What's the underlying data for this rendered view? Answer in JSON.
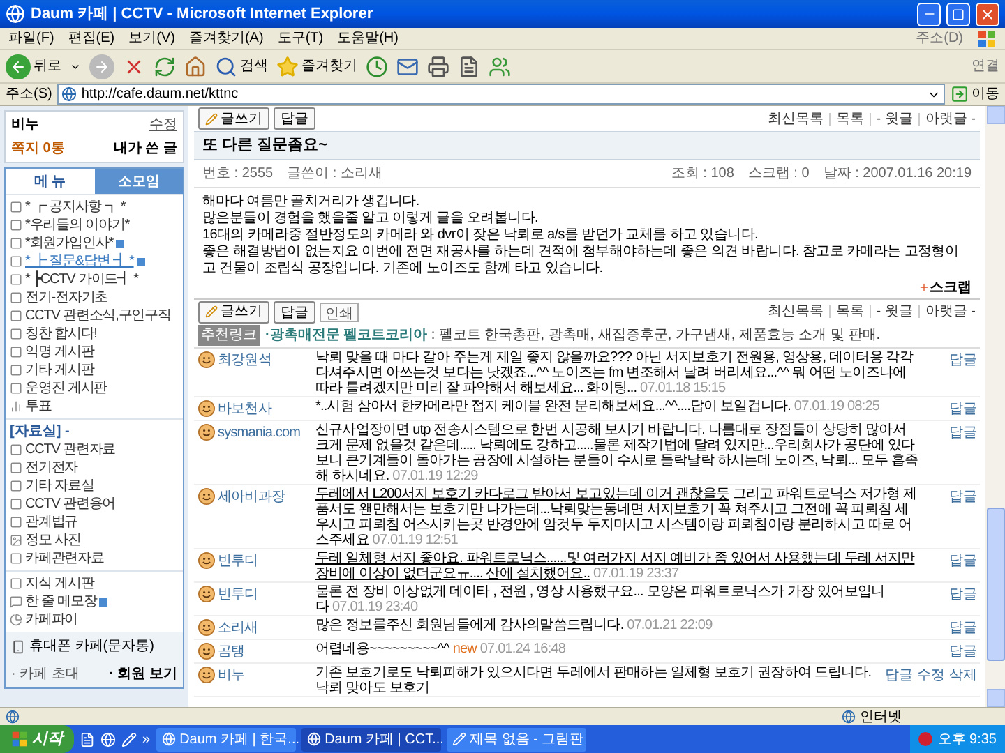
{
  "window": {
    "title": "Daum 카페 | CCTV - Microsoft Internet Explorer"
  },
  "menu_bar": {
    "items": [
      "파일(F)",
      "편집(E)",
      "보기(V)",
      "즐겨찾기(A)",
      "도구(T)",
      "도움말(H)"
    ],
    "right": "주소(D)"
  },
  "toolbar": {
    "back": "뒤로",
    "search": "검색",
    "favorites": "즐겨찾기",
    "links": "연결"
  },
  "address_bar": {
    "label": "주소(S)",
    "url": "http://cafe.daum.net/kttnc",
    "go": "이동"
  },
  "sidebar": {
    "user": {
      "name": "비누",
      "edit": "수정",
      "messages": "쪽지 0통",
      "my_posts": "내가 쓴 글"
    },
    "tabs": [
      {
        "label": "메 뉴",
        "selected": true
      },
      {
        "label": "소모임",
        "selected": false
      }
    ],
    "groups": [
      {
        "items": [
          {
            "kind": "board",
            "label": "* ┏ 공지사항 ┓ *",
            "new": false,
            "selected": false
          },
          {
            "kind": "board",
            "label": "*우리들의 이야기*",
            "new": false,
            "selected": false
          },
          {
            "kind": "board",
            "label": "*회원가입인사*",
            "new": true,
            "selected": false
          },
          {
            "kind": "board",
            "label": "* ┣ 질문&답변 ┫ *",
            "new": true,
            "selected": true
          },
          {
            "kind": "board",
            "label": "* ┣CCTV 가이드┫ *",
            "new": false,
            "selected": false
          },
          {
            "kind": "board",
            "label": "전기-전자기초",
            "new": false,
            "selected": false
          },
          {
            "kind": "board",
            "label": "CCTV 관련소식,구인구직",
            "new": false,
            "selected": false
          },
          {
            "kind": "board",
            "label": "칭찬 합시다!",
            "new": false,
            "selected": false
          },
          {
            "kind": "board",
            "label": "익명 게시판",
            "new": false,
            "selected": false
          },
          {
            "kind": "board",
            "label": "기타 게시판",
            "new": false,
            "selected": false
          },
          {
            "kind": "board",
            "label": "운영진 게시판",
            "new": false,
            "selected": false
          },
          {
            "kind": "poll",
            "label": "투표",
            "new": false,
            "selected": false
          }
        ]
      },
      {
        "header": "[자료실] -",
        "items": [
          {
            "kind": "board",
            "label": "CCTV 관련자료",
            "new": false,
            "selected": false
          },
          {
            "kind": "board",
            "label": "전기전자",
            "new": false,
            "selected": false
          },
          {
            "kind": "board",
            "label": "기타 자료실",
            "new": false,
            "selected": false
          },
          {
            "kind": "board",
            "label": "CCTV 관련용어",
            "new": false,
            "selected": false
          },
          {
            "kind": "board",
            "label": "관계법규",
            "new": false,
            "selected": false
          },
          {
            "kind": "photo",
            "label": "정모 사진",
            "new": false,
            "selected": false
          },
          {
            "kind": "board",
            "label": "카페관련자료",
            "new": false,
            "selected": false
          }
        ]
      },
      {
        "items": [
          {
            "kind": "board",
            "label": "지식 게시판",
            "new": false,
            "selected": false
          },
          {
            "kind": "memo",
            "label": "한 줄 메모장",
            "new": true,
            "selected": false
          },
          {
            "kind": "pie",
            "label": "카페파이",
            "new": false,
            "selected": false
          }
        ]
      }
    ],
    "mobile": "휴대폰 카페(문자통)",
    "footer_links": [
      "· 카페 초대",
      "· 회원 보기"
    ]
  },
  "post": {
    "buttons": [
      {
        "kind": "write",
        "label": "글쓰기"
      },
      {
        "kind": "plain",
        "label": "답글"
      }
    ],
    "nav_links": [
      "최신목록",
      "목록",
      "- 윗글",
      "아랫글 -"
    ],
    "title": "또 다른 질문좀요~",
    "meta_left": [
      "번호 : 2555",
      "글쓴이 : 소리새"
    ],
    "meta_right": [
      "조회 : 108",
      "스크랩 : 0",
      "날짜 : 2007.01.16 20:19"
    ],
    "body": [
      "해마다 여름만 골치거리가 생깁니다.",
      "많은분들이 경험을 했을줄 알고 이렇게 글을 오려봅니다.",
      "16대의 카메라중 절반정도의 카메라 와 dvr이 잦은 낙뢰로 a/s를 받던가 교체를 하고 있습니다.",
      "좋은 해결방법이 없는지요 이번에 전면 재공사를 하는데 견적에 첨부해야하는데 좋은 의견 바랍니다. 참고로 카메라는 고정형이고 건물이 조립식 공장입니다. 기존에 노이즈도 함께 타고 있습니다."
    ],
    "scrap": "스크랩",
    "buttons_2": [
      {
        "kind": "write",
        "label": "글쓰기"
      },
      {
        "kind": "plain",
        "label": "답글"
      },
      {
        "kind": "small",
        "label": "인쇄"
      }
    ],
    "nav_links_2": [
      "최신목록",
      "목록",
      "- 윗글",
      "아랫글 -"
    ],
    "ad": {
      "label": "추천링크",
      "link": "·광촉매전문 펠코트코리아",
      "text": ": 펠코트 한국총판, 광촉매, 새집증후군, 가구냄새, 제품효능 소개 및 판매."
    }
  },
  "comments": [
    {
      "name": "최강원석",
      "text": "낙뢰 맞을 때 마다 갈아 주는게 제일 좋지 않을까요??? 아닌 서지보호기 전원용, 영상용, 데이터용 각각 다셔주시면 아쓰는것 보다는 낫겠죠...^^ 노이즈는 fm 변조해서 날려 버리세요...^^ 뭐 어떤 노이즈냐에 따라 틀려겠지만 미리 잘 파악해서 해보세요... 화이팅...",
      "date": "07.01.18 15:15",
      "actions": [
        "답글"
      ]
    },
    {
      "name": "바보천사",
      "text": "*..시험 삼아서 한카메라만 접지 케이블 완전 분리해보세요...^^....답이 보일겁니다.",
      "date": "07.01.19 08:25",
      "actions": [
        "답글"
      ]
    },
    {
      "name": "sysmania.com",
      "text": "신규사업장이면 utp 전송시스템으로 한번 시공해 보시기 바랍니다. 나름대로 장점들이 상당히 많아서 크게 문제 없을것 같은데..... 낙뢰에도 강하고.....물론 제작기법에 달려 있지만...우리회사가 공단에 있다보니 큰기계들이 돌아가는 공장에 시설하는 분들이 수시로 들락날락 하시는데 노이즈, 낙뢰... 모두 흡족해 하시네요.",
      "date": "07.01.19 12:29",
      "actions": [
        "답글"
      ]
    },
    {
      "name": "세아비과장",
      "underlined": "두레에서 L200서지 보호기 카다로그 받아서 보고있는데 이거 괜찮을듯",
      "text": " 그리고 파워트로닉스 저가형 제품서도 왠만해서는 보호기만 나가는데...낙뢰맞는동네면 서지보호기 꼭 쳐주시고 그전에 꼭 피뢰침 세우시고 피뢰침 어스시키는곳 반경안에 암것두 두지마시고 시스템이랑 피뢰침이랑 분리하시고 따로 어스주세요",
      "date": "07.01.19 12:51",
      "actions": [
        "답글"
      ]
    },
    {
      "name": "빈투디",
      "underlined": "두레 일체형 서지 좋아요. 파워트로닉스......및 여러가지 서지 예비가 좀 있어서 사용했는데 두레 서지만 장비에 이상이 없더군요ㅠ.... 산에 설치했어요..",
      "date": "07.01.19 23:37",
      "actions": [
        "답글"
      ]
    },
    {
      "name": "빈투디",
      "text": "물론 전 장비 이상없게 데이타 , 전원 , 영상 사용했구요... 모양은 파워트로닉스가 가장 있어보입니다",
      "date": "07.01.19 23:40",
      "actions": [
        "답글"
      ]
    },
    {
      "name": "소리새",
      "text": "많은 정보를주신 회원님들에게 감사의말씀드립니다.",
      "date": "07.01.21 22:09",
      "actions": [
        "답글"
      ]
    },
    {
      "name": "곰탱",
      "text": "어렵네용~~~~~~~~~^^",
      "badge": "new",
      "date": "07.01.24 16:48",
      "actions": [
        "답글"
      ]
    },
    {
      "name": "비누",
      "text": "기존 보호기로도 낙뢰피해가 있으시다면 두레에서 판매하는 일체형 보호기 권장하여 드립니다. 낙뢰 맞아도 보호기",
      "actions": [
        "답글",
        "수정",
        "삭제"
      ]
    }
  ],
  "status_bar": {
    "zone": "인터넷"
  },
  "taskbar": {
    "start": "시작",
    "more": "»",
    "tasks": [
      {
        "label": "Daum 카페 | 한국...",
        "kind": "browser",
        "selected": false
      },
      {
        "label": "Daum 카페 | CCT...",
        "kind": "browser",
        "selected": true
      },
      {
        "label": "제목 없음 - 그림판",
        "kind": "paint",
        "selected": false
      }
    ],
    "clock": "오후 9:35"
  }
}
